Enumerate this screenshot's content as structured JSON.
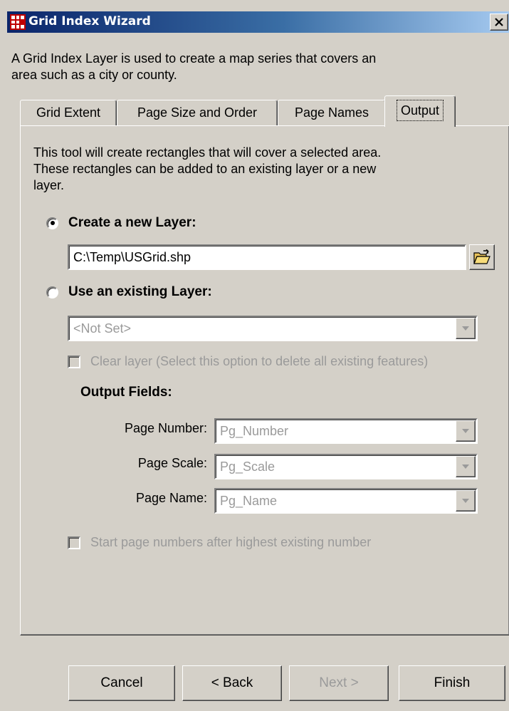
{
  "window": {
    "title": "Grid Index Wizard",
    "icon": "grid-icon",
    "close_label": "×",
    "intro": "A Grid Index Layer is used to create a map series that covers an\narea such as a city or county."
  },
  "tabs": [
    {
      "label": "Grid Extent",
      "active": false
    },
    {
      "label": "Page Size and Order",
      "active": false
    },
    {
      "label": "Page Names",
      "active": false
    },
    {
      "label": "Output",
      "active": true
    }
  ],
  "panel": {
    "description": "This tool will create rectangles that will cover a selected area.\nThese rectangles can be added to an existing layer or a new\nlayer.",
    "create_new": {
      "label": "Create a new Layer:",
      "selected": true,
      "path_value": "C:\\Temp\\USGrid.shp",
      "browse_icon": "folder-open-icon"
    },
    "use_existing": {
      "label": "Use an existing Layer:",
      "selected": false,
      "layer_value": "<Not Set>",
      "clear_label": "Clear layer (Select this option to delete all existing features)"
    },
    "output_fields": {
      "heading": "Output Fields:",
      "page_number_label": "Page Number:",
      "page_number_value": "Pg_Number",
      "page_scale_label": "Page Scale:",
      "page_scale_value": "Pg_Scale",
      "page_name_label": "Page Name:",
      "page_name_value": "Pg_Name"
    },
    "start_numbers_label": "Start page numbers after highest existing number"
  },
  "buttons": {
    "cancel": "Cancel",
    "back": "< Back",
    "next": "Next >",
    "finish": "Finish"
  },
  "colors": {
    "titlebar_start": "#0a246a",
    "titlebar_end": "#a6caf0",
    "face": "#d4d0c8",
    "disabled_text": "#9a9a9a"
  }
}
